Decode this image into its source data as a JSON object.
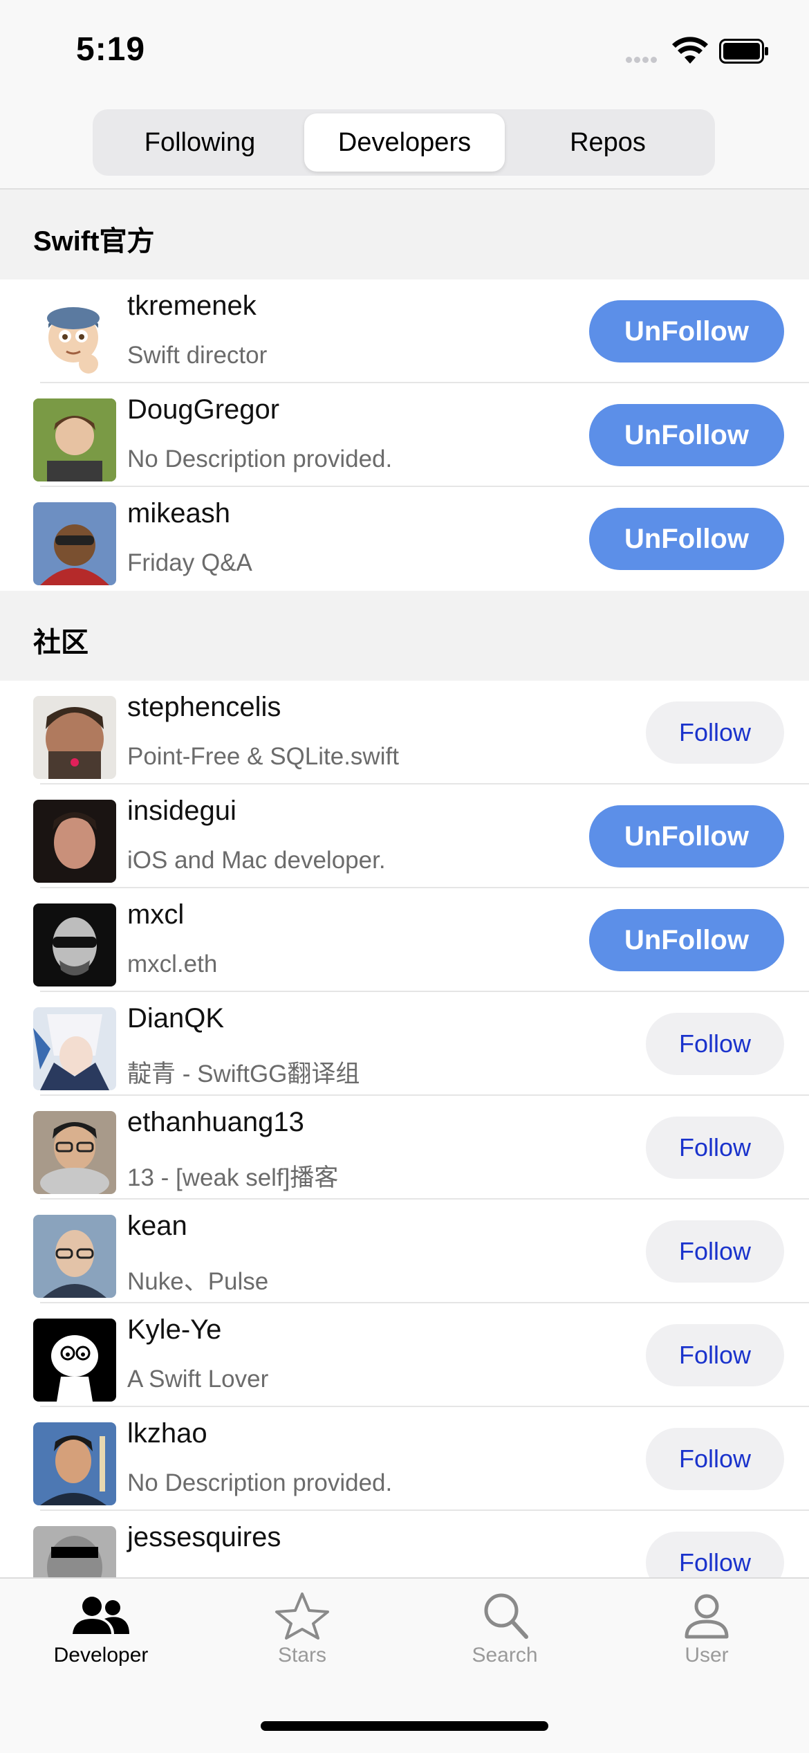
{
  "status_bar": {
    "time": "5:19"
  },
  "segments": {
    "items": [
      "Following",
      "Developers",
      "Repos"
    ],
    "active": "Developers"
  },
  "sections": [
    {
      "title": "Swift官方",
      "rows": [
        {
          "name": "tkremenek",
          "desc": "Swift director",
          "button": "UnFollow",
          "avatar_color": "#e9d8c2"
        },
        {
          "name": "DougGregor",
          "desc": "No Description provided.",
          "button": "UnFollow",
          "avatar_color": "#6b8a3a"
        },
        {
          "name": "mikeash",
          "desc": "Friday Q&A",
          "button": "UnFollow",
          "avatar_color": "#4a6fa8"
        }
      ]
    },
    {
      "title": "社区",
      "rows": [
        {
          "name": "stephencelis",
          "desc": "Point-Free & SQLite.swift",
          "button": "Follow",
          "avatar_color": "#5a4236"
        },
        {
          "name": "insidegui",
          "desc": "iOS and Mac developer.",
          "button": "UnFollow",
          "avatar_color": "#2a2420"
        },
        {
          "name": "mxcl",
          "desc": "mxcl.eth",
          "button": "UnFollow",
          "avatar_color": "#1a1a1a"
        },
        {
          "name": "DianQK",
          "desc": "靛青 - SwiftGG翻译组",
          "button": "Follow",
          "avatar_color": "#8aa6c9"
        },
        {
          "name": "ethanhuang13",
          "desc": "13 - [weak self]播客",
          "button": "Follow",
          "avatar_color": "#8a7a6a"
        },
        {
          "name": "kean",
          "desc": "Nuke、Pulse",
          "button": "Follow",
          "avatar_color": "#7e94ad"
        },
        {
          "name": "Kyle-Ye",
          "desc": "A Swift Lover",
          "button": "Follow",
          "avatar_color": "#111111"
        },
        {
          "name": "lkzhao",
          "desc": "No Description provided.",
          "button": "Follow",
          "avatar_color": "#3d5c8a"
        },
        {
          "name": "jessesquires",
          "desc": "",
          "button": "Follow",
          "avatar_color": "#9a9a9a"
        }
      ]
    }
  ],
  "tabbar": {
    "items": [
      {
        "label": "Developer",
        "icon": "people-icon",
        "active": true
      },
      {
        "label": "Stars",
        "icon": "star-icon",
        "active": false
      },
      {
        "label": "Search",
        "icon": "search-icon",
        "active": false
      },
      {
        "label": "User",
        "icon": "person-icon",
        "active": false
      }
    ]
  }
}
